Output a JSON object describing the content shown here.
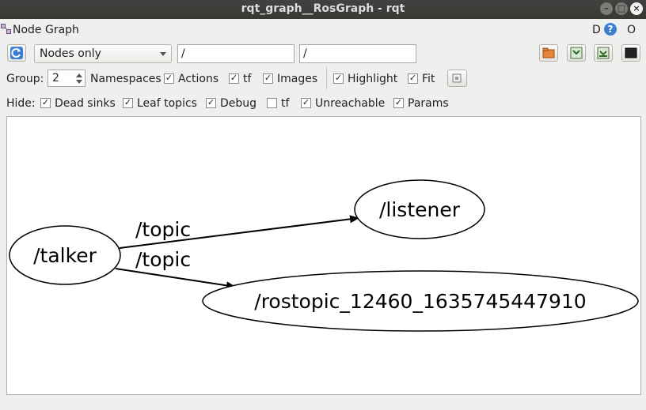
{
  "window": {
    "title": "rqt_graph__RosGraph - rqt"
  },
  "plugin": {
    "title": "Node Graph",
    "d_label": "D",
    "help_label": "?",
    "o_label": "O"
  },
  "toolbar": {
    "filter_mode": "Nodes only",
    "node_filter": "/",
    "topic_filter": "/"
  },
  "options": {
    "group_label": "Group:",
    "group_value": "2",
    "namespaces_label": "Namespaces",
    "namespaces_checked": true,
    "actions_label": "Actions",
    "actions_checked": true,
    "tf_label": "tf",
    "tf_checked": true,
    "images_label": "Images",
    "images_checked": true,
    "highlight_label": "Highlight",
    "highlight_checked": true,
    "fit_label": "Fit",
    "fit_checked": true
  },
  "hide": {
    "hide_label": "Hide:",
    "dead_sinks_label": "Dead sinks",
    "dead_sinks_checked": true,
    "leaf_topics_label": "Leaf topics",
    "leaf_topics_checked": true,
    "debug_label": "Debug",
    "debug_checked": true,
    "tf_label": "tf",
    "tf_checked": false,
    "unreachable_label": "Unreachable",
    "unreachable_checked": true,
    "params_label": "Params",
    "params_checked": true
  },
  "graph": {
    "nodes": [
      {
        "id": "talker",
        "label": "/talker"
      },
      {
        "id": "listener",
        "label": "/listener"
      },
      {
        "id": "rostopic",
        "label": "/rostopic_12460_1635745447910"
      }
    ],
    "edges": [
      {
        "from": "talker",
        "to": "listener",
        "label": "/topic"
      },
      {
        "from": "talker",
        "to": "rostopic",
        "label": "/topic"
      }
    ]
  }
}
